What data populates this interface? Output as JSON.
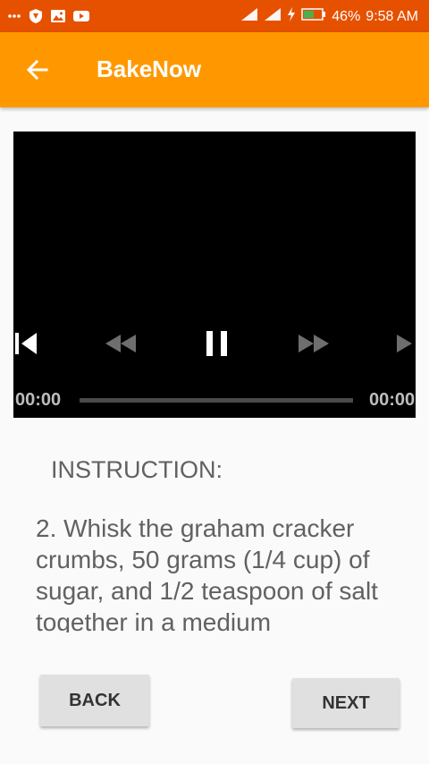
{
  "status_bar": {
    "left_icons": [
      "more-icon",
      "shield-icon",
      "image-icon",
      "youtube-icon"
    ],
    "battery": "46%",
    "time": "9:58 AM",
    "color": "#e65100"
  },
  "app_bar": {
    "title": "BakeNow",
    "color": "#ff9800"
  },
  "video_player": {
    "current_time": "00:00",
    "duration": "00:00",
    "progress": 0,
    "state": "playing"
  },
  "instruction": {
    "label": "INSTRUCTION:",
    "text": "2. Whisk the graham cracker crumbs, 50 grams (1/4 cup) of sugar, and 1/2 teaspoon of salt together in a medium"
  },
  "buttons": {
    "back": "BACK",
    "next": "NEXT"
  }
}
